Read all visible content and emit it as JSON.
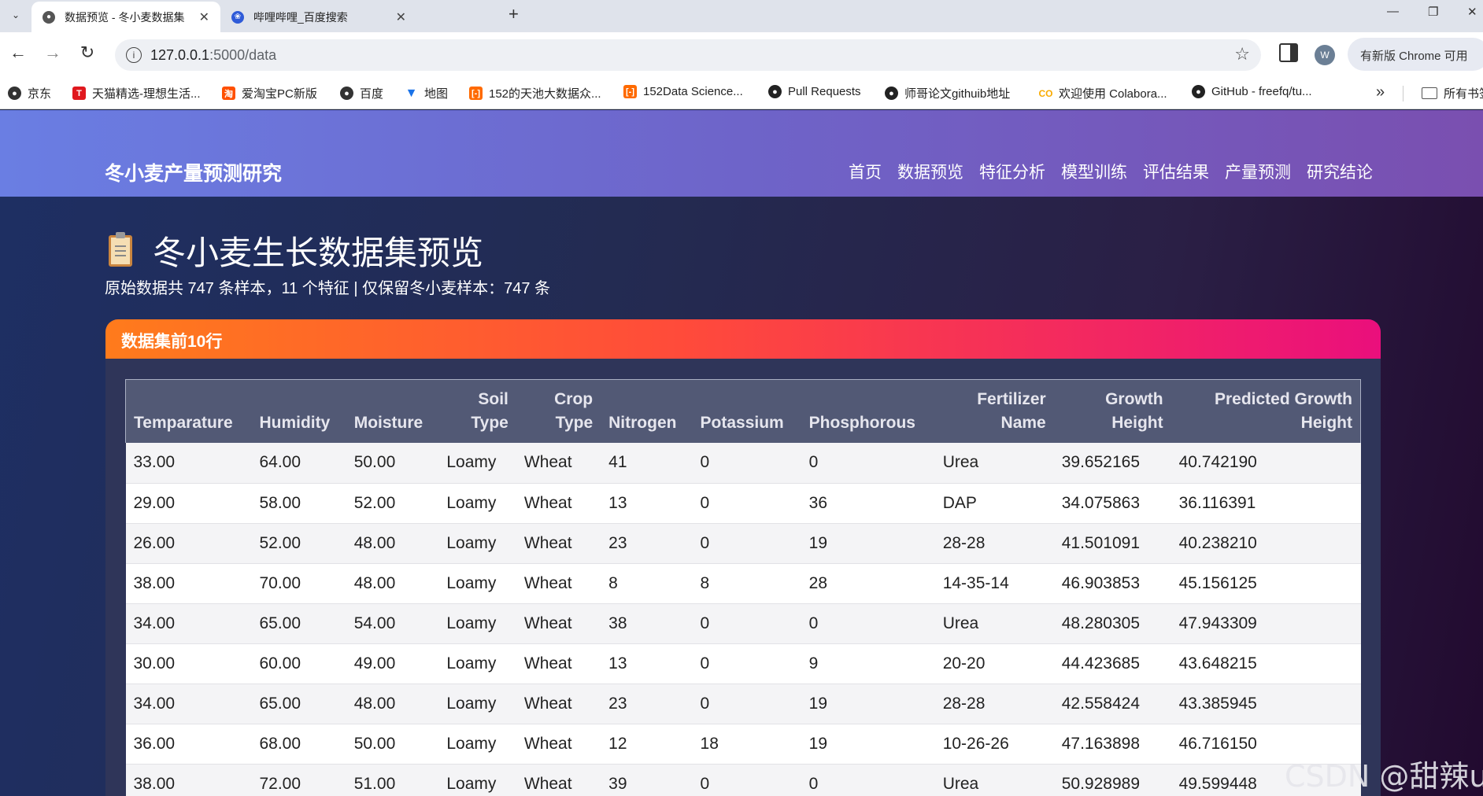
{
  "browser": {
    "tabs": [
      {
        "title": "数据预览 - 冬小麦数据集",
        "active": true,
        "icon": "globe-icon"
      },
      {
        "title": "哔哩哔哩_百度搜索",
        "active": false,
        "icon": "baidu-paw-icon"
      }
    ],
    "url_host": "127.0.0.1",
    "url_path": ":5000/data",
    "update_button": "有新版 Chrome 可用",
    "profile_initial": "W",
    "bookmarks": [
      {
        "label": "京东",
        "icon": "globe-icon"
      },
      {
        "label": "天猫精选-理想生活...",
        "icon": "tmall-icon"
      },
      {
        "label": "爱淘宝PC新版",
        "icon": "taobao-icon"
      },
      {
        "label": "百度",
        "icon": "globe-icon"
      },
      {
        "label": "地图",
        "icon": "map-pin-icon"
      },
      {
        "label": "152的天池大数据众...",
        "icon": "tianchi-icon"
      },
      {
        "label": "152Data Science...",
        "icon": "tianchi-icon"
      },
      {
        "label": "Pull Requests",
        "icon": "github-icon"
      },
      {
        "label": "师哥论文githuib地址",
        "icon": "github-icon"
      },
      {
        "label": "欢迎使用 Colabora...",
        "icon": "colab-icon"
      },
      {
        "label": "GitHub - freefq/tu...",
        "icon": "github-icon"
      }
    ],
    "all_bookmarks": "所有书签"
  },
  "site": {
    "brand": "冬小麦产量预测研究",
    "nav": [
      "首页",
      "数据预览",
      "特征分析",
      "模型训练",
      "评估结果",
      "产量预测",
      "研究结论"
    ]
  },
  "main": {
    "title": "冬小麦生长数据集预览",
    "subtitle": "原始数据共 747 条样本，11 个特征 | 仅保留冬小麦样本：747 条",
    "card_title": "数据集前10行"
  },
  "table": {
    "headers": [
      [
        "",
        "Temparature"
      ],
      [
        "",
        "Humidity"
      ],
      [
        "",
        "Moisture"
      ],
      [
        "Soil",
        "Type"
      ],
      [
        "Crop",
        "Type"
      ],
      [
        "",
        "Nitrogen"
      ],
      [
        "",
        "Potassium"
      ],
      [
        "",
        "Phosphorous"
      ],
      [
        "Fertilizer",
        "Name"
      ],
      [
        "Growth",
        "Height"
      ],
      [
        "Predicted Growth",
        "Height"
      ]
    ],
    "rows": [
      [
        "33.00",
        "64.00",
        "50.00",
        "Loamy",
        "Wheat",
        "41",
        "0",
        "0",
        "Urea",
        "39.652165",
        "40.742190"
      ],
      [
        "29.00",
        "58.00",
        "52.00",
        "Loamy",
        "Wheat",
        "13",
        "0",
        "36",
        "DAP",
        "34.075863",
        "36.116391"
      ],
      [
        "26.00",
        "52.00",
        "48.00",
        "Loamy",
        "Wheat",
        "23",
        "0",
        "19",
        "28-28",
        "41.501091",
        "40.238210"
      ],
      [
        "38.00",
        "70.00",
        "48.00",
        "Loamy",
        "Wheat",
        "8",
        "8",
        "28",
        "14-35-14",
        "46.903853",
        "45.156125"
      ],
      [
        "34.00",
        "65.00",
        "54.00",
        "Loamy",
        "Wheat",
        "38",
        "0",
        "0",
        "Urea",
        "48.280305",
        "47.943309"
      ],
      [
        "30.00",
        "60.00",
        "49.00",
        "Loamy",
        "Wheat",
        "13",
        "0",
        "9",
        "20-20",
        "44.423685",
        "43.648215"
      ],
      [
        "34.00",
        "65.00",
        "48.00",
        "Loamy",
        "Wheat",
        "23",
        "0",
        "19",
        "28-28",
        "42.558424",
        "43.385945"
      ],
      [
        "36.00",
        "68.00",
        "50.00",
        "Loamy",
        "Wheat",
        "12",
        "18",
        "19",
        "10-26-26",
        "47.163898",
        "46.716150"
      ],
      [
        "38.00",
        "72.00",
        "51.00",
        "Loamy",
        "Wheat",
        "39",
        "0",
        "0",
        "Urea",
        "50.928989",
        "49.599448"
      ]
    ]
  },
  "watermark": "CSDN @甜辣uu",
  "colors": {
    "nav_gradient_start": "#6a7ee3",
    "nav_gradient_end": "#7a4fb0",
    "card_header_start": "#ff7b1c",
    "card_header_end": "#ea0f7c"
  }
}
